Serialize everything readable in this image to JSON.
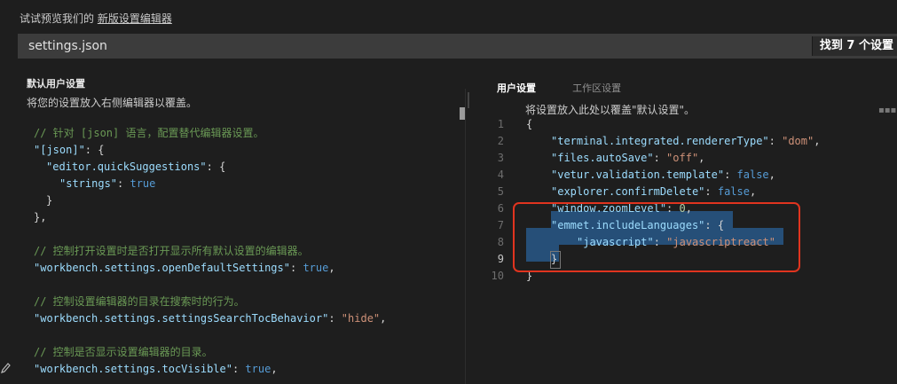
{
  "notice": {
    "prefix": "试试预览我们的",
    "link": "新版设置编辑器"
  },
  "search": {
    "value": "settings.json",
    "count": "找到 7 个设置"
  },
  "left": {
    "title": "默认用户设置",
    "description": "将您的设置放入右侧编辑器以覆盖。",
    "lines": {
      "l1": "// 针对 [json] 语言，配置替代编辑器设置。",
      "l2k": "\"[json]\"",
      "l2p": ": {",
      "l3k": "\"editor.quickSuggestions\"",
      "l3p": ": {",
      "l4k": "\"strings\"",
      "l4p": ": ",
      "l4v": "true",
      "l5": "}",
      "l6": "},",
      "l7": "// 控制打开设置时是否打开显示所有默认设置的编辑器。",
      "l8k": "\"workbench.settings.openDefaultSettings\"",
      "l8p": ": ",
      "l8v": "true",
      "l8e": ",",
      "l9": "// 控制设置编辑器的目录在搜索时的行为。",
      "l10k": "\"workbench.settings.settingsSearchTocBehavior\"",
      "l10p": ": ",
      "l10v": "\"hide\"",
      "l10e": ",",
      "l11": "// 控制是否显示设置编辑器的目录。",
      "l12k": "\"workbench.settings.tocVisible\"",
      "l12p": ": ",
      "l12v": "true",
      "l12e": ","
    }
  },
  "right": {
    "tabs": {
      "user": "用户设置",
      "workspace": "工作区设置"
    },
    "description": "将设置放入此处以覆盖\"默认设置\"。",
    "gutter": [
      "1",
      "2",
      "3",
      "4",
      "5",
      "6",
      "7",
      "8",
      "9",
      "10"
    ],
    "lines": {
      "r1": "{",
      "r2k": "\"terminal.integrated.rendererType\"",
      "r2p": ": ",
      "r2v": "\"dom\"",
      "r2e": ",",
      "r3k": "\"files.autoSave\"",
      "r3p": ": ",
      "r3v": "\"off\"",
      "r3e": ",",
      "r4k": "\"vetur.validation.template\"",
      "r4p": ": ",
      "r4v": "false",
      "r4e": ",",
      "r5k": "\"explorer.confirmDelete\"",
      "r5p": ": ",
      "r5v": "false",
      "r5e": ",",
      "r6k": "\"window.zoomLevel\"",
      "r6p": ": ",
      "r6v": "0",
      "r6e": ",",
      "r7k": "\"emmet.includeLanguages\"",
      "r7p": ": {",
      "r8k": "\"javascript\"",
      "r8p": ": ",
      "r8v": "\"javascriptreact\"",
      "r9": "}",
      "r10": "}"
    }
  },
  "icons": {
    "edit": "pencil-icon"
  },
  "colors": {
    "highlight_box": "#e0341f",
    "selection": "#264f78"
  }
}
